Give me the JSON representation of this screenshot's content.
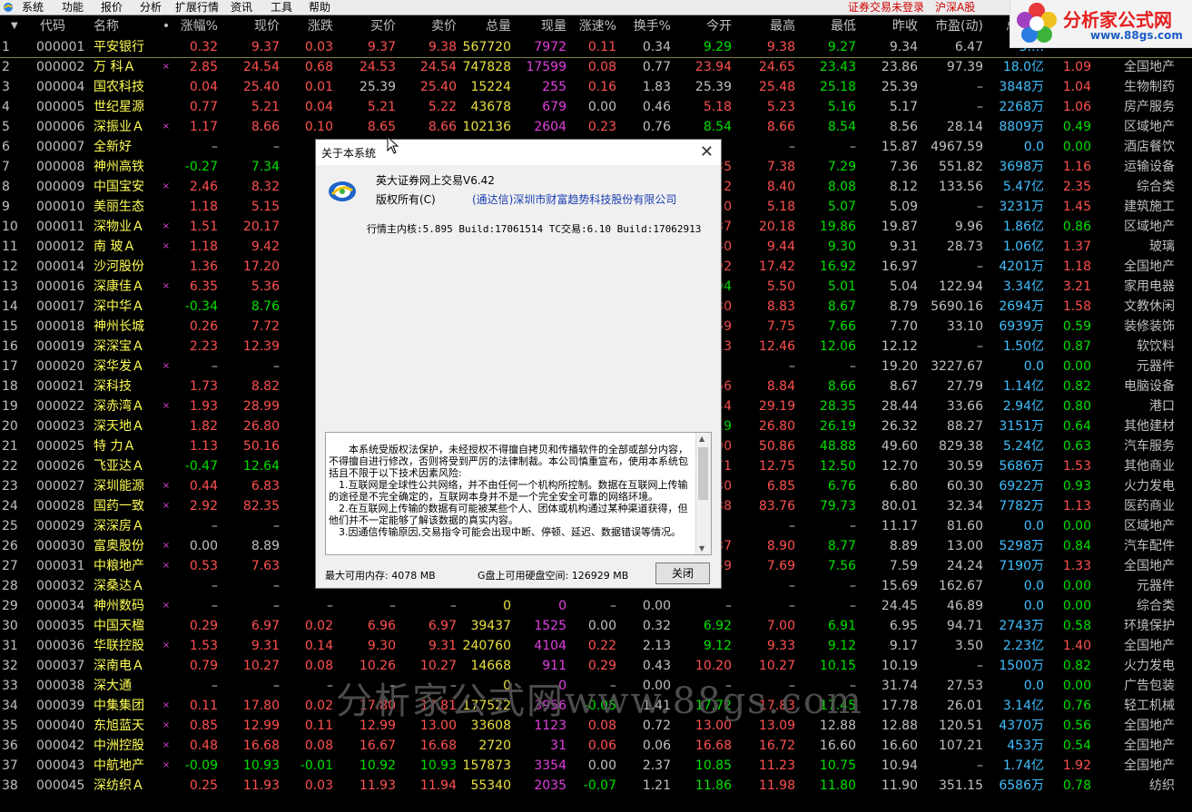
{
  "menu": {
    "items": [
      "系统",
      "功能",
      "报价",
      "分析",
      "扩展行情",
      "资讯",
      "工具",
      "帮助"
    ],
    "status_login": "证券交易未登录",
    "status_market": "沪深A股"
  },
  "brand": {
    "name": "分析家公式网",
    "url": "www.88gs.com"
  },
  "table": {
    "headers": [
      "代码",
      "名称",
      "•",
      "涨幅%",
      "现价",
      "涨跌",
      "买价",
      "卖价",
      "总量",
      "现量",
      "涨速%",
      "换手%",
      "今开",
      "最高",
      "最低",
      "昨收",
      "市盈(动)",
      "总金额",
      "量比",
      "细分行业"
    ],
    "rows": [
      {
        "i": "1",
        "code": "000001",
        "name": "平安银行",
        "mark": "",
        "chg": "0.32",
        "price": "9.37",
        "diff": "0.03",
        "bid": "9.37",
        "ask": "9.38",
        "vol": "567720",
        "cvol": "7972",
        "spd": "0.11",
        "turn": "0.34",
        "open": "9.29",
        "high": "9.38",
        "low": "9.27",
        "close": "9.34",
        "pe": "6.47",
        "amt": "5.…",
        "ratio": "",
        "ind": ""
      },
      {
        "i": "2",
        "code": "000002",
        "name": "万 科Ａ",
        "mark": "×",
        "chg": "2.85",
        "price": "24.54",
        "diff": "0.68",
        "bid": "24.53",
        "ask": "24.54",
        "vol": "747828",
        "cvol": "17599",
        "spd": "0.08",
        "turn": "0.77",
        "open": "23.94",
        "high": "24.65",
        "low": "23.43",
        "close": "23.86",
        "pe": "97.39",
        "amt": "18.0亿",
        "ratio": "1.09",
        "ind": "全国地产"
      },
      {
        "i": "3",
        "code": "000004",
        "name": "国农科技",
        "mark": "",
        "chg": "0.04",
        "price": "25.40",
        "diff": "0.01",
        "bid": "25.39",
        "ask": "25.40",
        "vol": "15224",
        "cvol": "255",
        "spd": "0.16",
        "turn": "1.83",
        "open": "25.39",
        "high": "25.48",
        "low": "25.18",
        "close": "25.39",
        "pe": "–",
        "amt": "3848万",
        "ratio": "1.04",
        "ind": "生物制药"
      },
      {
        "i": "4",
        "code": "000005",
        "name": "世纪星源",
        "mark": "",
        "chg": "0.77",
        "price": "5.21",
        "diff": "0.04",
        "bid": "5.21",
        "ask": "5.22",
        "vol": "43678",
        "cvol": "679",
        "spd": "0.00",
        "turn": "0.46",
        "open": "5.18",
        "high": "5.23",
        "low": "5.16",
        "close": "5.17",
        "pe": "–",
        "amt": "2268万",
        "ratio": "1.06",
        "ind": "房产服务"
      },
      {
        "i": "5",
        "code": "000006",
        "name": "深振业Ａ",
        "mark": "×",
        "chg": "1.17",
        "price": "8.66",
        "diff": "0.10",
        "bid": "8.65",
        "ask": "8.66",
        "vol": "102136",
        "cvol": "2604",
        "spd": "0.23",
        "turn": "0.76",
        "open": "8.54",
        "high": "8.66",
        "low": "8.54",
        "close": "8.56",
        "pe": "28.14",
        "amt": "8809万",
        "ratio": "0.49",
        "ind": "区域地产"
      },
      {
        "i": "6",
        "code": "000007",
        "name": "全新好",
        "mark": "",
        "chg": "–",
        "price": "–",
        "diff": "",
        "bid": "",
        "ask": "",
        "vol": "",
        "cvol": "",
        "spd": "",
        "turn": "",
        "open": "",
        "high": "–",
        "low": "–",
        "close": "15.87",
        "pe": "4967.59",
        "amt": "0.0",
        "ratio": "0.00",
        "ind": "酒店餐饮"
      },
      {
        "i": "7",
        "code": "000008",
        "name": "神州高铁",
        "mark": "",
        "chg": "-0.27",
        "price": "7.34",
        "diff": "-0",
        "bid": "",
        "ask": "",
        "vol": "",
        "cvol": "",
        "spd": "",
        "turn": "",
        "open": "35",
        "high": "7.38",
        "low": "7.29",
        "close": "7.36",
        "pe": "551.82",
        "amt": "3698万",
        "ratio": "1.16",
        "ind": "运输设备"
      },
      {
        "i": "8",
        "code": "000009",
        "name": "中国宝安",
        "mark": "×",
        "chg": "2.46",
        "price": "8.32",
        "diff": "0",
        "bid": "",
        "ask": "",
        "vol": "",
        "cvol": "",
        "spd": "",
        "turn": "",
        "open": "12",
        "high": "8.40",
        "low": "8.08",
        "close": "8.12",
        "pe": "133.56",
        "amt": "5.47亿",
        "ratio": "2.35",
        "ind": "综合类"
      },
      {
        "i": "9",
        "code": "000010",
        "name": "美丽生态",
        "mark": "",
        "chg": "1.18",
        "price": "5.15",
        "diff": "0",
        "bid": "",
        "ask": "",
        "vol": "",
        "cvol": "",
        "spd": "",
        "turn": "",
        "open": "10",
        "high": "5.18",
        "low": "5.07",
        "close": "5.09",
        "pe": "–",
        "amt": "3231万",
        "ratio": "1.45",
        "ind": "建筑施工"
      },
      {
        "i": "10",
        "code": "000011",
        "name": "深物业Ａ",
        "mark": "×",
        "chg": "1.51",
        "price": "20.17",
        "diff": "0",
        "bid": "",
        "ask": "",
        "vol": "",
        "cvol": "",
        "spd": "",
        "turn": "",
        "open": "87",
        "high": "20.18",
        "low": "19.86",
        "close": "19.87",
        "pe": "9.96",
        "amt": "1.86亿",
        "ratio": "0.86",
        "ind": "区域地产"
      },
      {
        "i": "11",
        "code": "000012",
        "name": "南 玻Ａ",
        "mark": "×",
        "chg": "1.18",
        "price": "9.42",
        "diff": "0",
        "bid": "",
        "ask": "",
        "vol": "",
        "cvol": "",
        "spd": "",
        "turn": "",
        "open": "30",
        "high": "9.44",
        "low": "9.30",
        "close": "9.31",
        "pe": "28.73",
        "amt": "1.06亿",
        "ratio": "1.37",
        "ind": "玻璃"
      },
      {
        "i": "12",
        "code": "000014",
        "name": "沙河股份",
        "mark": "",
        "chg": "1.36",
        "price": "17.20",
        "diff": "0",
        "bid": "",
        "ask": "",
        "vol": "",
        "cvol": "",
        "spd": "",
        "turn": "",
        "open": "92",
        "high": "17.42",
        "low": "16.92",
        "close": "16.97",
        "pe": "–",
        "amt": "4201万",
        "ratio": "1.18",
        "ind": "全国地产"
      },
      {
        "i": "13",
        "code": "000016",
        "name": "深康佳Ａ",
        "mark": "×",
        "chg": "6.35",
        "price": "5.36",
        "diff": "0",
        "bid": "",
        "ask": "",
        "vol": "",
        "cvol": "",
        "spd": "",
        "turn": "",
        "open": "04",
        "high": "5.50",
        "low": "5.01",
        "close": "5.04",
        "pe": "122.94",
        "amt": "3.34亿",
        "ratio": "3.21",
        "ind": "家用电器"
      },
      {
        "i": "14",
        "code": "000017",
        "name": "深中华Ａ",
        "mark": "",
        "chg": "-0.34",
        "price": "8.76",
        "diff": "-0",
        "bid": "",
        "ask": "",
        "vol": "",
        "cvol": "",
        "spd": "",
        "turn": "",
        "open": "80",
        "high": "8.83",
        "low": "8.67",
        "close": "8.79",
        "pe": "5690.16",
        "amt": "2694万",
        "ratio": "1.58",
        "ind": "文教休闲"
      },
      {
        "i": "15",
        "code": "000018",
        "name": "神州长城",
        "mark": "",
        "chg": "0.26",
        "price": "7.72",
        "diff": "0",
        "bid": "",
        "ask": "",
        "vol": "",
        "cvol": "",
        "spd": "",
        "turn": "",
        "open": "69",
        "high": "7.75",
        "low": "7.66",
        "close": "7.70",
        "pe": "33.10",
        "amt": "6939万",
        "ratio": "0.59",
        "ind": "装修装饰"
      },
      {
        "i": "16",
        "code": "000019",
        "name": "深深宝Ａ",
        "mark": "",
        "chg": "2.23",
        "price": "12.39",
        "diff": "0",
        "bid": "",
        "ask": "",
        "vol": "",
        "cvol": "",
        "spd": "",
        "turn": "",
        "open": "13",
        "high": "12.46",
        "low": "12.06",
        "close": "12.12",
        "pe": "–",
        "amt": "1.50亿",
        "ratio": "0.87",
        "ind": "软饮料"
      },
      {
        "i": "17",
        "code": "000020",
        "name": "深华发Ａ",
        "mark": "×",
        "chg": "–",
        "price": "–",
        "diff": "",
        "bid": "",
        "ask": "",
        "vol": "",
        "cvol": "",
        "spd": "",
        "turn": "",
        "open": "",
        "high": "–",
        "low": "–",
        "close": "19.20",
        "pe": "3227.67",
        "amt": "0.0",
        "ratio": "0.00",
        "ind": "元器件"
      },
      {
        "i": "18",
        "code": "000021",
        "name": "深科技",
        "mark": "",
        "chg": "1.73",
        "price": "8.82",
        "diff": "0",
        "bid": "",
        "ask": "",
        "vol": "",
        "cvol": "",
        "spd": "",
        "turn": "",
        "open": "66",
        "high": "8.84",
        "low": "8.66",
        "close": "8.67",
        "pe": "27.79",
        "amt": "1.14亿",
        "ratio": "0.82",
        "ind": "电脑设备"
      },
      {
        "i": "19",
        "code": "000022",
        "name": "深赤湾Ａ",
        "mark": "×",
        "chg": "1.93",
        "price": "28.99",
        "diff": "0",
        "bid": "",
        "ask": "",
        "vol": "",
        "cvol": "",
        "spd": "",
        "turn": "",
        "open": "44",
        "high": "29.19",
        "low": "28.35",
        "close": "28.44",
        "pe": "33.66",
        "amt": "2.94亿",
        "ratio": "0.80",
        "ind": "港口"
      },
      {
        "i": "20",
        "code": "000023",
        "name": "深天地Ａ",
        "mark": "",
        "chg": "1.82",
        "price": "26.80",
        "diff": "0",
        "bid": "",
        "ask": "",
        "vol": "",
        "cvol": "",
        "spd": "",
        "turn": "",
        "open": "19",
        "high": "26.80",
        "low": "26.19",
        "close": "26.32",
        "pe": "88.27",
        "amt": "3151万",
        "ratio": "0.64",
        "ind": "其他建材"
      },
      {
        "i": "21",
        "code": "000025",
        "name": "特 力Ａ",
        "mark": "",
        "chg": "1.13",
        "price": "50.16",
        "diff": "0",
        "bid": "",
        "ask": "",
        "vol": "",
        "cvol": "",
        "spd": "",
        "turn": "",
        "open": "90",
        "high": "50.86",
        "low": "48.88",
        "close": "49.60",
        "pe": "829.38",
        "amt": "5.24亿",
        "ratio": "0.63",
        "ind": "汽车服务"
      },
      {
        "i": "22",
        "code": "000026",
        "name": "飞亚达Ａ",
        "mark": "",
        "chg": "-0.47",
        "price": "12.64",
        "diff": "-0",
        "bid": "",
        "ask": "",
        "vol": "",
        "cvol": "",
        "spd": "",
        "turn": "",
        "open": "71",
        "high": "12.75",
        "low": "12.50",
        "close": "12.70",
        "pe": "30.59",
        "amt": "5686万",
        "ratio": "1.53",
        "ind": "其他商业"
      },
      {
        "i": "23",
        "code": "000027",
        "name": "深圳能源",
        "mark": "×",
        "chg": "0.44",
        "price": "6.83",
        "diff": "0",
        "bid": "",
        "ask": "",
        "vol": "",
        "cvol": "",
        "spd": "",
        "turn": "",
        "open": "80",
        "high": "6.85",
        "low": "6.76",
        "close": "6.80",
        "pe": "60.30",
        "amt": "6922万",
        "ratio": "0.93",
        "ind": "火力发电"
      },
      {
        "i": "24",
        "code": "000028",
        "name": "国药一致",
        "mark": "×",
        "chg": "2.92",
        "price": "82.35",
        "diff": "2",
        "bid": "",
        "ask": "",
        "vol": "",
        "cvol": "",
        "spd": "",
        "turn": "",
        "open": "88",
        "high": "83.76",
        "low": "79.73",
        "close": "80.01",
        "pe": "32.34",
        "amt": "7782万",
        "ratio": "1.13",
        "ind": "医药商业"
      },
      {
        "i": "25",
        "code": "000029",
        "name": "深深房Ａ",
        "mark": "",
        "chg": "–",
        "price": "–",
        "diff": "",
        "bid": "",
        "ask": "",
        "vol": "",
        "cvol": "",
        "spd": "",
        "turn": "",
        "open": "",
        "high": "–",
        "low": "–",
        "close": "11.17",
        "pe": "81.60",
        "amt": "0.0",
        "ratio": "0.00",
        "ind": "区域地产"
      },
      {
        "i": "26",
        "code": "000030",
        "name": "富奥股份",
        "mark": "×",
        "chg": "0.00",
        "price": "8.89",
        "diff": "0",
        "bid": "",
        "ask": "",
        "vol": "",
        "cvol": "",
        "spd": "",
        "turn": "",
        "open": "87",
        "high": "8.90",
        "low": "8.77",
        "close": "8.89",
        "pe": "13.00",
        "amt": "5298万",
        "ratio": "0.84",
        "ind": "汽车配件"
      },
      {
        "i": "27",
        "code": "000031",
        "name": "中粮地产",
        "mark": "×",
        "chg": "0.53",
        "price": "7.63",
        "diff": "0",
        "bid": "",
        "ask": "",
        "vol": "",
        "cvol": "",
        "spd": "",
        "turn": "",
        "open": "59",
        "high": "7.69",
        "low": "7.56",
        "close": "7.59",
        "pe": "24.24",
        "amt": "7190万",
        "ratio": "1.33",
        "ind": "全国地产"
      },
      {
        "i": "28",
        "code": "000032",
        "name": "深桑达Ａ",
        "mark": "",
        "chg": "–",
        "price": "–",
        "diff": "",
        "bid": "",
        "ask": "",
        "vol": "",
        "cvol": "",
        "spd": "",
        "turn": "",
        "open": "",
        "high": "–",
        "low": "–",
        "close": "15.69",
        "pe": "162.67",
        "amt": "0.0",
        "ratio": "0.00",
        "ind": "元器件"
      },
      {
        "i": "29",
        "code": "000034",
        "name": "神州数码",
        "mark": "×",
        "chg": "–",
        "price": "–",
        "diff": "–",
        "bid": "–",
        "ask": "–",
        "vol": "0",
        "cvol": "0",
        "spd": "–",
        "turn": "0.00",
        "open": "–",
        "high": "–",
        "low": "–",
        "close": "24.45",
        "pe": "46.89",
        "amt": "0.0",
        "ratio": "0.00",
        "ind": "综合类"
      },
      {
        "i": "30",
        "code": "000035",
        "name": "中国天楹",
        "mark": "",
        "chg": "0.29",
        "price": "6.97",
        "diff": "0.02",
        "bid": "6.96",
        "ask": "6.97",
        "vol": "39437",
        "cvol": "1525",
        "spd": "0.00",
        "turn": "0.32",
        "open": "6.92",
        "high": "7.00",
        "low": "6.91",
        "close": "6.95",
        "pe": "94.71",
        "amt": "2743万",
        "ratio": "0.58",
        "ind": "环境保护"
      },
      {
        "i": "31",
        "code": "000036",
        "name": "华联控股",
        "mark": "×",
        "chg": "1.53",
        "price": "9.31",
        "diff": "0.14",
        "bid": "9.30",
        "ask": "9.31",
        "vol": "240760",
        "cvol": "4104",
        "spd": "0.22",
        "turn": "2.13",
        "open": "9.12",
        "high": "9.33",
        "low": "9.12",
        "close": "9.17",
        "pe": "3.50",
        "amt": "2.23亿",
        "ratio": "1.40",
        "ind": "全国地产"
      },
      {
        "i": "32",
        "code": "000037",
        "name": "深南电Ａ",
        "mark": "",
        "chg": "0.79",
        "price": "10.27",
        "diff": "0.08",
        "bid": "10.26",
        "ask": "10.27",
        "vol": "14668",
        "cvol": "911",
        "spd": "0.29",
        "turn": "0.43",
        "open": "10.20",
        "high": "10.27",
        "low": "10.15",
        "close": "10.19",
        "pe": "–",
        "amt": "1500万",
        "ratio": "0.82",
        "ind": "火力发电"
      },
      {
        "i": "33",
        "code": "000038",
        "name": "深大通",
        "mark": "",
        "chg": "–",
        "price": "–",
        "diff": "–",
        "bid": "–",
        "ask": "–",
        "vol": "0",
        "cvol": "0",
        "spd": "–",
        "turn": "0.00",
        "open": "–",
        "high": "–",
        "low": "–",
        "close": "31.74",
        "pe": "27.53",
        "amt": "0.0",
        "ratio": "0.00",
        "ind": "广告包装"
      },
      {
        "i": "34",
        "code": "000039",
        "name": "中集集团",
        "mark": "×",
        "chg": "0.11",
        "price": "17.80",
        "diff": "0.02",
        "bid": "17.80",
        "ask": "17.81",
        "vol": "177522",
        "cvol": "3956",
        "spd": "-0.05",
        "turn": "1.41",
        "open": "17.72",
        "high": "17.83",
        "low": "17.45",
        "close": "17.78",
        "pe": "26.01",
        "amt": "3.14亿",
        "ratio": "0.76",
        "ind": "轻工机械"
      },
      {
        "i": "35",
        "code": "000040",
        "name": "东旭蓝天",
        "mark": "×",
        "chg": "0.85",
        "price": "12.99",
        "diff": "0.11",
        "bid": "12.99",
        "ask": "13.00",
        "vol": "33608",
        "cvol": "1123",
        "spd": "0.08",
        "turn": "0.72",
        "open": "13.00",
        "high": "13.09",
        "low": "12.88",
        "close": "12.88",
        "pe": "120.51",
        "amt": "4370万",
        "ratio": "0.56",
        "ind": "全国地产"
      },
      {
        "i": "36",
        "code": "000042",
        "name": "中洲控股",
        "mark": "×",
        "chg": "0.48",
        "price": "16.68",
        "diff": "0.08",
        "bid": "16.67",
        "ask": "16.68",
        "vol": "2720",
        "cvol": "31",
        "spd": "0.06",
        "turn": "0.06",
        "open": "16.68",
        "high": "16.72",
        "low": "16.60",
        "close": "16.60",
        "pe": "107.21",
        "amt": "453万",
        "ratio": "0.54",
        "ind": "全国地产"
      },
      {
        "i": "37",
        "code": "000043",
        "name": "中航地产",
        "mark": "×",
        "chg": "-0.09",
        "price": "10.93",
        "diff": "-0.01",
        "bid": "10.92",
        "ask": "10.93",
        "vol": "157873",
        "cvol": "3354",
        "spd": "0.00",
        "turn": "2.37",
        "open": "10.85",
        "high": "11.23",
        "low": "10.75",
        "close": "10.94",
        "pe": "–",
        "amt": "1.74亿",
        "ratio": "1.92",
        "ind": "全国地产"
      },
      {
        "i": "38",
        "code": "000045",
        "name": "深纺织Ａ",
        "mark": "",
        "chg": "0.25",
        "price": "11.93",
        "diff": "0.03",
        "bid": "11.93",
        "ask": "11.94",
        "vol": "55340",
        "cvol": "2035",
        "spd": "-0.07",
        "turn": "1.21",
        "open": "11.86",
        "high": "11.98",
        "low": "11.80",
        "close": "11.90",
        "pe": "351.15",
        "amt": "6586万",
        "ratio": "0.78",
        "ind": "纺织"
      }
    ]
  },
  "watermark": "分析家公式网www.88gs.com",
  "dialog": {
    "title": "关于本系统",
    "product": "英大证券网上交易V6.42",
    "copyright": "版权所有(C)",
    "company": "(通达信)深圳市财富趋势科技股份有限公司",
    "build": "行情主内核:5.895 Build:17061514 TC交易:6.10 Build:17062913",
    "disclaimer": [
      "本系统受版权法保护，未经授权不得擅自拷贝和传播软件的全部或部分内容，不得擅自进行修改，否则将受到严厉的法律制裁。本公司慎重宣布，使用本系统包括且不限于以下技术因素风险:",
      "1.互联网是全球性公共网络，并不由任何一个机构所控制。数据在互联网上传输的途径是不完全确定的，互联网本身并不是一个完全安全可靠的网络环境。",
      "2.在互联网上传输的数据有可能被某些个人、团体或机构通过某种渠道获得，但他们并不一定能够了解该数据的真实内容。",
      "3.因通信传输原因,交易指令可能会出现中断、停顿、延迟、数据错误等情况。"
    ],
    "memory": "最大可用内存: 4078 MB",
    "disk": "G盘上可用硬盘空间: 126929 MB",
    "close_label": "关闭"
  }
}
